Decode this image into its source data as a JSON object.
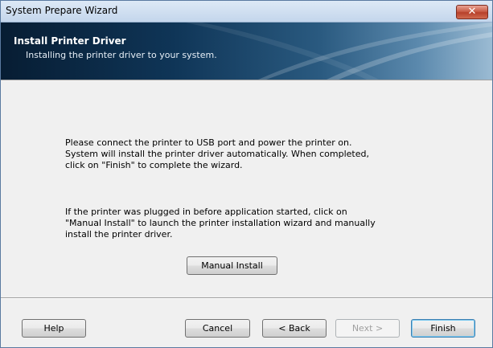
{
  "window": {
    "title": "System Prepare Wizard",
    "close_glyph": "✕"
  },
  "header": {
    "title": "Install Printer Driver",
    "subtitle": "Installing the printer driver to your system."
  },
  "body": {
    "paragraph1": "Please connect the printer to USB port and power the printer on.\nSystem will install the printer driver automatically. When completed,\nclick on \"Finish\" to complete the wizard.",
    "paragraph2": "If the printer was plugged in before application started, click on\n\"Manual Install\" to launch the printer installation wizard and manually\ninstall the printer driver.",
    "manual_install_label": "Manual Install"
  },
  "footer": {
    "help_label": "Help",
    "cancel_label": "Cancel",
    "back_label": "< Back",
    "next_label": "Next >",
    "finish_label": "Finish"
  }
}
